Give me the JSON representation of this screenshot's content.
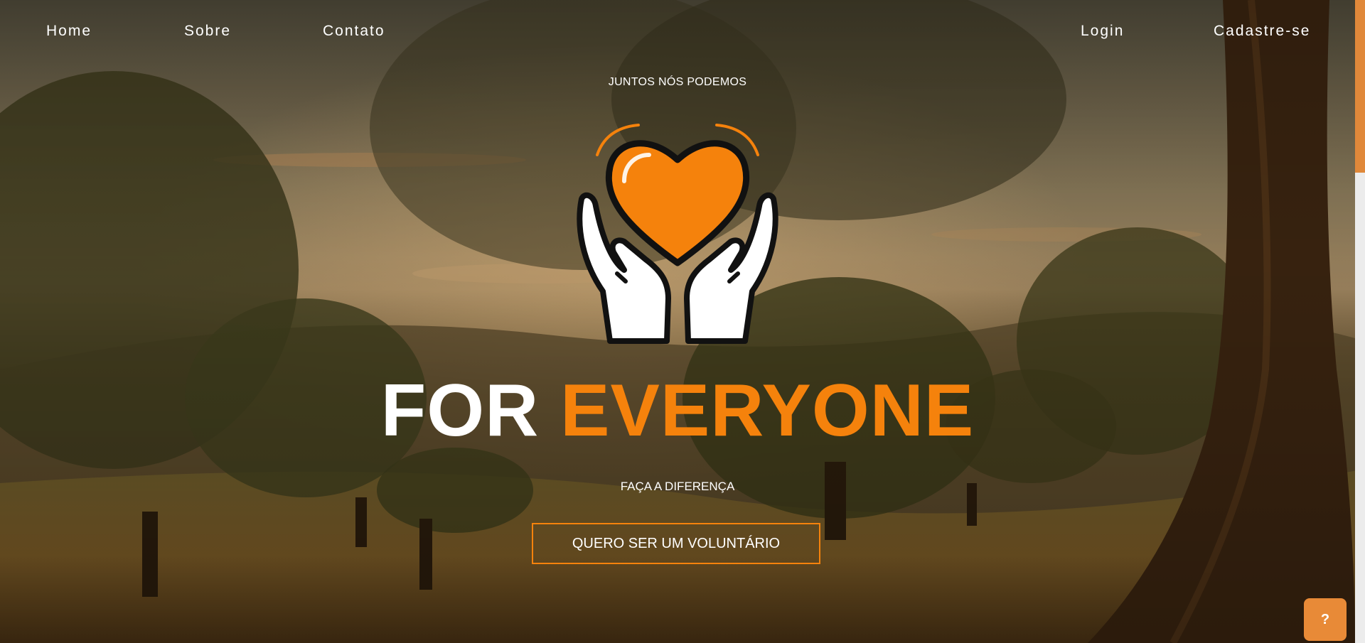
{
  "nav": {
    "home": "Home",
    "sobre": "Sobre",
    "contato": "Contato",
    "login": "Login",
    "cadastre": "Cadastre-se"
  },
  "hero": {
    "tagline": "JUNTOS NÓS PODEMOS",
    "logo_icon": "heart-in-hands-icon",
    "headline_white": "FOR",
    "headline_accent": "EVERYONE",
    "subline": "FAÇA A DIFERENÇA",
    "cta_label": "QUERO SER UM VOLUNTÁRIO"
  },
  "help_button": {
    "label": "?"
  },
  "colors": {
    "accent": "#f5820c",
    "help_button": "#e88a37",
    "scroll_thumb": "#e0883a",
    "text": "#ffffff"
  }
}
